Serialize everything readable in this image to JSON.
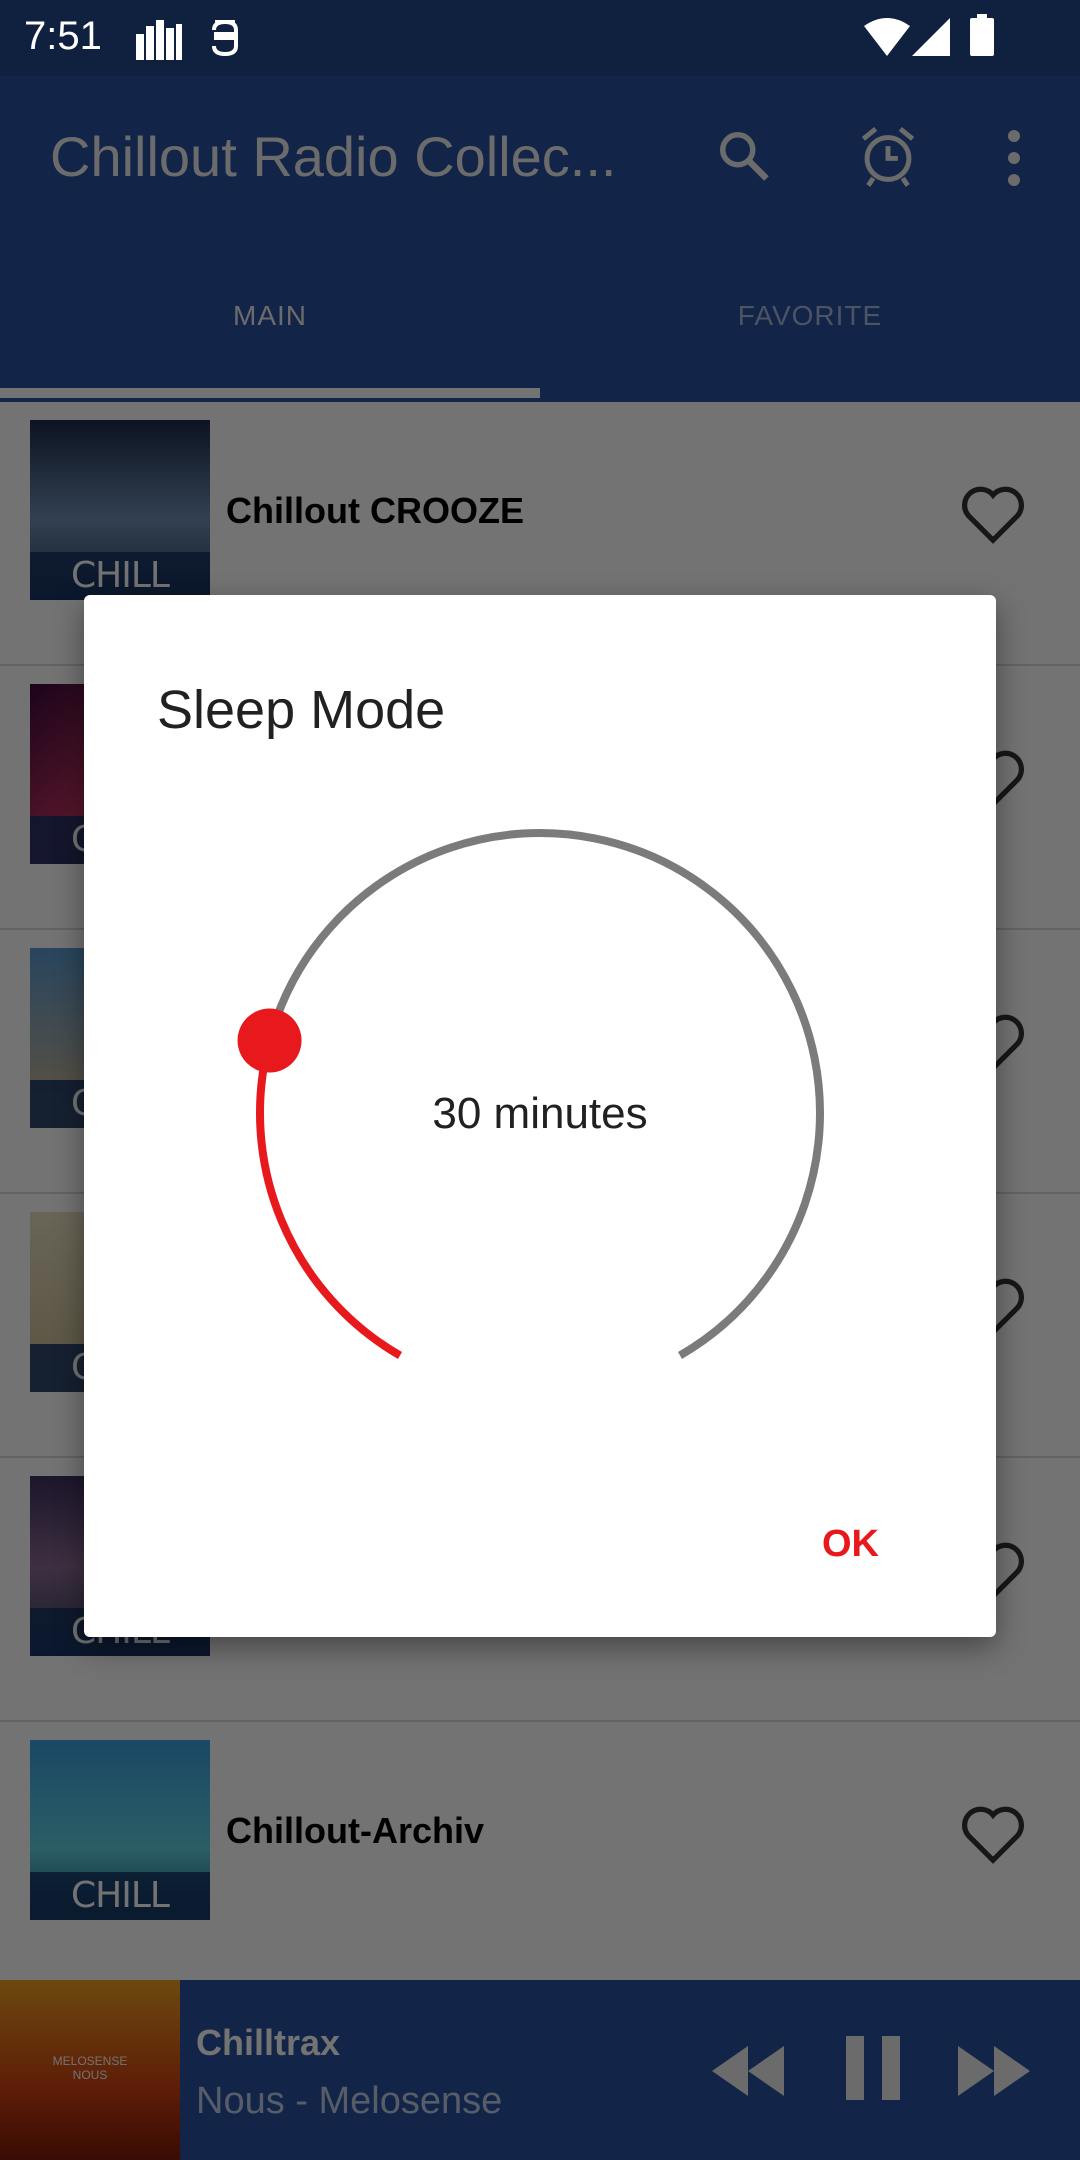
{
  "status_bar": {
    "time": "7:51",
    "icons": [
      "equalizer-icon",
      "app-notification-icon",
      "wifi-icon",
      "cell-signal-icon",
      "battery-icon"
    ]
  },
  "app_bar": {
    "title": "Chillout Radio Collec...",
    "actions": [
      "search-icon",
      "alarm-icon",
      "more-vert-icon"
    ]
  },
  "tabs": [
    {
      "label": "MAIN",
      "selected": true
    },
    {
      "label": "FAVORITE",
      "selected": false
    }
  ],
  "stations": [
    {
      "title": "Chillout CROOZE",
      "logo_text": "CHILL OUT"
    },
    {
      "title": "",
      "logo_text": "CHILL OUT"
    },
    {
      "title": "",
      "logo_text": "CHILL OUT"
    },
    {
      "title": "",
      "logo_text": "CHILL OUT"
    },
    {
      "title": "",
      "logo_text": "CHILL OUT"
    },
    {
      "title": "Chillout-Archiv",
      "logo_text": "CHILL OUT"
    }
  ],
  "player": {
    "station": "Chilltrax",
    "track": "Nous - Melosense",
    "album_art_text": "MELOSENSE NOUS",
    "state": "playing"
  },
  "dialog": {
    "title": "Sleep Mode",
    "timer_label": "30 minutes",
    "timer_fraction": 0.25,
    "ok_label": "OK"
  },
  "colors": {
    "accent": "#e8191c",
    "track": "#7b7b7b",
    "app_bar": "#28509e"
  }
}
